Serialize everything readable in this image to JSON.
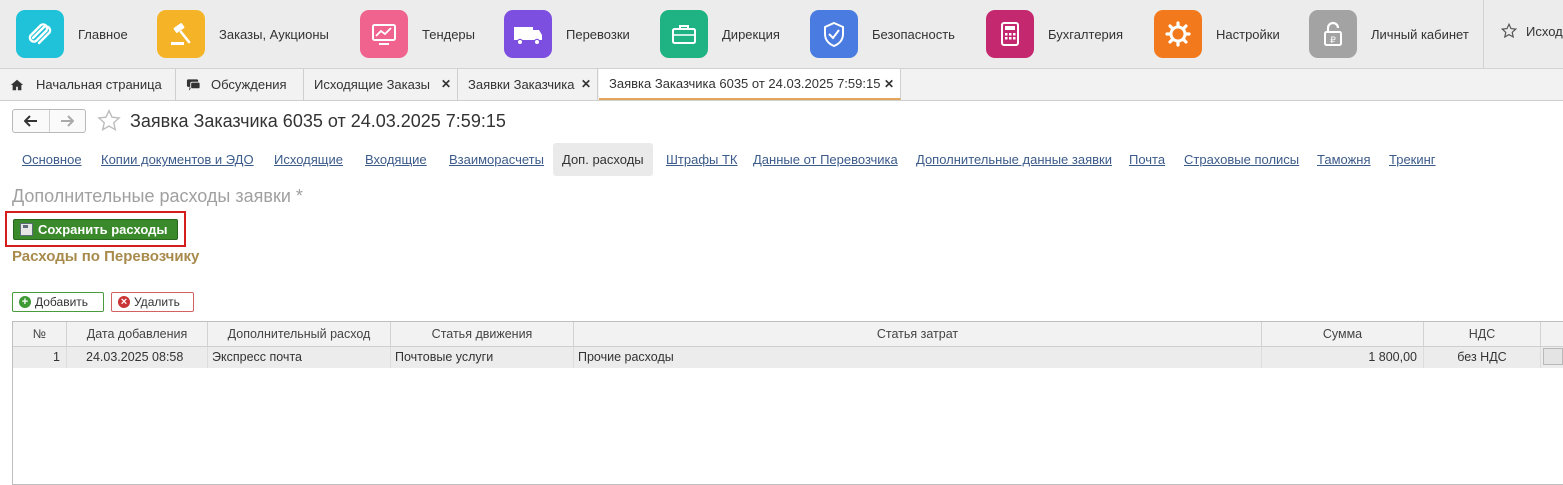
{
  "sections": [
    {
      "label": "Главное",
      "icon": "logo-icon",
      "color": "#1fc2d8"
    },
    {
      "label": "Заказы, Аукционы",
      "icon": "auction-gavel-icon",
      "color": "#f5b428"
    },
    {
      "label": "Тендеры",
      "icon": "chart-monitor-icon",
      "color": "#f0638f"
    },
    {
      "label": "Перевозки",
      "icon": "truck-icon",
      "color": "#7d4fe0"
    },
    {
      "label": "Дирекция",
      "icon": "briefcase-icon",
      "color": "#1fb383"
    },
    {
      "label": "Безопасность",
      "icon": "shield-check-icon",
      "color": "#4a7be0"
    },
    {
      "label": "Бухгалтерия",
      "icon": "calculator-icon",
      "color": "#c4286e"
    },
    {
      "label": "Настройки",
      "icon": "gear-icon",
      "color": "#f27a1d"
    },
    {
      "label": "Личный кабинет",
      "icon": "padlock-ruble-icon",
      "color": "#a3a3a3"
    }
  ],
  "favorites_label": "Исходящие Заказы",
  "tabs": [
    {
      "label": "Начальная страница",
      "icon": "home-icon"
    },
    {
      "label": "Обсуждения",
      "icon": "chat-icon"
    },
    {
      "label": "Исходящие Заказы",
      "closable": true
    },
    {
      "label": "Заявки Заказчика",
      "closable": true
    },
    {
      "label": "Заявка Заказчика 6035 от 24.03.2025 7:59:15",
      "closable": true,
      "active": true
    }
  ],
  "form": {
    "title": "Заявка Заказчика 6035 от 24.03.2025 7:59:15",
    "subtabs": [
      "Основное",
      "Копии документов и ЭДО",
      "Исходящие",
      "Входящие",
      "Взаиморасчеты",
      "Доп. расходы",
      "Штрафы ТК",
      "Данные от Перевозчика",
      "Дополнительные данные заявки",
      "Почта",
      "Страховые полисы",
      "Таможня",
      "Трекинг"
    ],
    "active_subtab": "Доп. расходы",
    "section_title": "Дополнительные расходы заявки *",
    "save_button": "Сохранить расходы",
    "group_title": "Расходы по Перевозчику",
    "add_button": "Добавить",
    "delete_button": "Удалить"
  },
  "table": {
    "columns": [
      "№",
      "Дата добавления",
      "Дополнительный расход",
      "Статья движения",
      "Статья затрат",
      "Сумма",
      "НДС"
    ],
    "rows": [
      [
        "1",
        "24.03.2025 08:58",
        "Экспресс почта",
        "Почтовые услуги",
        "Прочие расходы",
        "1 800,00",
        "без НДС"
      ]
    ]
  }
}
